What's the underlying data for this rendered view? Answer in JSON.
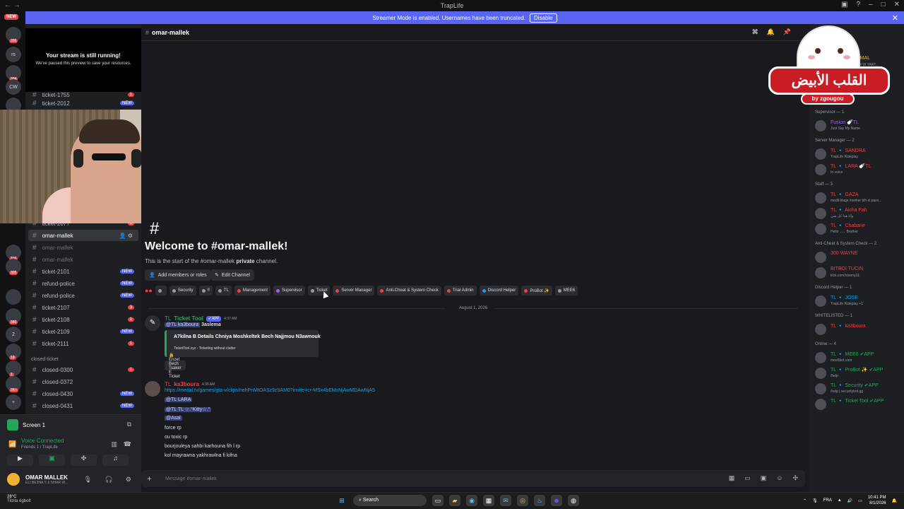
{
  "window": {
    "title": "TrapLife",
    "title_icon": "traplife-logo-icon"
  },
  "streamer_bar": {
    "text": "Streamer Mode is enabled. Usernames have been truncated.",
    "button": "Disable"
  },
  "server_rail": {
    "new_badge": "NEW",
    "servers": [
      {
        "label": "",
        "badge": "266"
      },
      {
        "label": "rs",
        "badge": ""
      },
      {
        "label": "",
        "badge": "304"
      },
      {
        "label": "CW",
        "badge": ""
      },
      {
        "label": "",
        "badge": "177"
      },
      {
        "label": "",
        "badge": "116"
      },
      {
        "label": "",
        "badge": "305"
      },
      {
        "label": "",
        "badge": ""
      },
      {
        "label": "",
        "badge": "380"
      },
      {
        "label": "2",
        "badge": ""
      },
      {
        "label": "",
        "badge": "19"
      },
      {
        "label": "",
        "badge": "1"
      },
      {
        "label": "",
        "badge": "2K+"
      }
    ]
  },
  "stream_preview": {
    "title": "Your stream is still running!",
    "subtitle": "We've paused this preview to save your resources."
  },
  "channels": {
    "items": [
      {
        "name": "ticket-1755",
        "badge": "1",
        "badge_color": "red",
        "partial": true
      },
      {
        "name": "ticket-2012",
        "badge": "NEW",
        "badge_color": "blue"
      },
      {
        "name": "ticket-2077",
        "badge": "1",
        "badge_color": "red",
        "partial": true
      },
      {
        "name": "omar-mallek",
        "active": true
      },
      {
        "name": "omar-mallek",
        "muted": true
      },
      {
        "name": "omar-mallek",
        "muted": true
      },
      {
        "name": "ticket-2101",
        "badge": "NEW",
        "badge_color": "blue"
      },
      {
        "name": "refund-police",
        "badge": "NEW",
        "badge_color": "blue"
      },
      {
        "name": "refund-police",
        "badge": "NEW",
        "badge_color": "blue"
      },
      {
        "name": "ticket-2107",
        "badge": "3",
        "badge_color": "red"
      },
      {
        "name": "ticket-2108",
        "badge": "1",
        "badge_color": "red"
      },
      {
        "name": "ticket-2109",
        "badge": "NEW",
        "badge_color": "blue"
      },
      {
        "name": "ticket-2111",
        "badge": "1",
        "badge_color": "red"
      }
    ],
    "category": "closed ticket",
    "closed": [
      {
        "name": "closed-0300",
        "badge": "1",
        "badge_color": "red"
      },
      {
        "name": "closed-0372",
        "badge": ""
      },
      {
        "name": "closed-0430",
        "badge": "NEW",
        "badge_color": "blue"
      },
      {
        "name": "closed-0431",
        "badge": "NEW",
        "badge_color": "blue"
      }
    ]
  },
  "voice": {
    "screen_label": "Screen 1",
    "connected": "Voice Connected",
    "location": "Friends 1 / TrapLife",
    "user_name": "OMAR MALLEK",
    "user_status": "ELI BE3NA Y..II NHAR W..."
  },
  "header": {
    "channel": "omar-mallek"
  },
  "welcome": {
    "title": "Welcome to #omar-mallek!",
    "sub_start": "This is the start of the #omar-mallek ",
    "sub_bold": "private",
    "sub_end": " channel.",
    "add_members": "Add members or roles",
    "edit_channel": "Edit Channel"
  },
  "roles": [
    {
      "name": "",
      "color": "#949ba4"
    },
    {
      "name": "Security",
      "color": "#949ba4"
    },
    {
      "name": "!!",
      "color": "#949ba4"
    },
    {
      "name": "TL",
      "color": "#949ba4"
    },
    {
      "name": "Management",
      "color": "#f23f42"
    },
    {
      "name": "Supervisor",
      "color": "#a35cf2"
    },
    {
      "name": "Ticket",
      "color": "#949ba4"
    },
    {
      "name": "Server Manager",
      "color": "#f23f42"
    },
    {
      "name": "Anti-Cheat & System Check",
      "color": "#f23f42"
    },
    {
      "name": "Trial Admin",
      "color": "#f23f42"
    },
    {
      "name": "Discord Helper",
      "color": "#00a8fc"
    },
    {
      "name": "ProBot ✨",
      "color": "#f23f42"
    },
    {
      "name": "MEE6",
      "color": "#949ba4"
    }
  ],
  "date_divider": "August 1, 2026",
  "messages": {
    "m1": {
      "author": "Ticket Tool",
      "prefix": "TL",
      "tag": "✔ APP",
      "time": "4:37 AM",
      "mention": "@TL",
      "mention_user": "ka3boura",
      "text": "3aslema",
      "embed_title": "A7kilna B Details Chniya Moshkeltek Bech Najjmou N3awnouk",
      "embed_footer": "TicketTool.xyz - Ticketing without clutter",
      "button": "🔒 Enzel Bech Tsaker E Ticket"
    },
    "m2": {
      "author": "ka3boura",
      "prefix": "TL",
      "time": "4:39 AM",
      "link": "https://medal.tv/games/gta-v/clips/nehPnMtOASz9z9AM0?invite=cr-MSx4bEMsNjAwMDAwNjA5",
      "mention1": "@TL",
      "mention1_user": "LARA",
      "mention2": "@TL",
      "mention2_user": "TL ☆.°Kitty☆.°",
      "mention3": "@Asal",
      "lines": [
        "force rp",
        "ou toxic rp",
        "bourjouleya sahbi karhouna fih l rp",
        "kol mayrawna yakhrawlna fi kifna"
      ]
    }
  },
  "input": {
    "placeholder": "Message #omar-mallek"
  },
  "members": {
    "top_item": {
      "name": "AR MAL",
      "status": "NHAR W YART..."
    },
    "groups": [
      {
        "title": "Supervisor — 1",
        "members": [
          {
            "name": "Fusion 🍼TL",
            "status": "Just Say My Name",
            "color": "#a35cf2"
          }
        ]
      },
      {
        "title": "Server Manager — 2",
        "members": [
          {
            "name": "TL 🔹 SANDRA",
            "status": "TrapLife Roleplay",
            "color": "#f23f42"
          },
          {
            "name": "TL 🔹 LARA 🍼TL",
            "status": "In voice",
            "color": "#f23f42"
          }
        ]
      },
      {
        "title": "Staff — 3",
        "members": [
          {
            "name": "TL 🔹 GAZA",
            "status": "medli blage inseker bih el pass...",
            "color": "#f23f42"
          },
          {
            "name": "TL 🔹 Aicha Fah",
            "status": "وأنا هذا كل ضي",
            "color": "#f23f42"
          },
          {
            "name": "TL 🔹 Chabane",
            "status": "Hello ...... Brother",
            "color": "#f23f42"
          }
        ]
      },
      {
        "title": "Anti-Cheat & System Check — 2",
        "members": [
          {
            "name": "300 WAYNE",
            "status": "",
            "color": "#f23f42"
          },
          {
            "name": "BITBOI TUCIN",
            "status": "kick.com/xtoony11",
            "color": "#f23f42"
          }
        ]
      },
      {
        "title": "Discord Helper — 1",
        "members": [
          {
            "name": "TL 🔹 JOSE",
            "status": "TrapLife Roleplay +1",
            "color": "#00a8fc"
          }
        ]
      },
      {
        "title": "WHITELISTED — 1",
        "members": [
          {
            "name": "TL 🔹 ka3boura",
            "status": "",
            "color": "#f23f42"
          }
        ]
      },
      {
        "title": "Online — 4",
        "members": [
          {
            "name": "TL 🔹 MEE6 ✔APP",
            "status": "mee6bot.com",
            "color": "#23a55a"
          },
          {
            "name": "TL 🔹 ProBot ✨ ✔APP",
            "status": "/help",
            "color": "#23a55a"
          },
          {
            "name": "TL 🔹 Security ✔APP",
            "status": "/help | securitybot.gg",
            "color": "#23a55a"
          },
          {
            "name": "TL 🔹 Ticket Tool ✔APP",
            "status": "",
            "color": "#23a55a"
          }
        ]
      }
    ]
  },
  "overlay": {
    "arabic": "القلب الأبيض",
    "by": "by zgougou"
  },
  "taskbar": {
    "temp": "28°C",
    "weather": "Tilzita égbolt",
    "search": "Search",
    "lang": "FRA",
    "time": "10:41 PM",
    "date": "8/1/2026"
  }
}
